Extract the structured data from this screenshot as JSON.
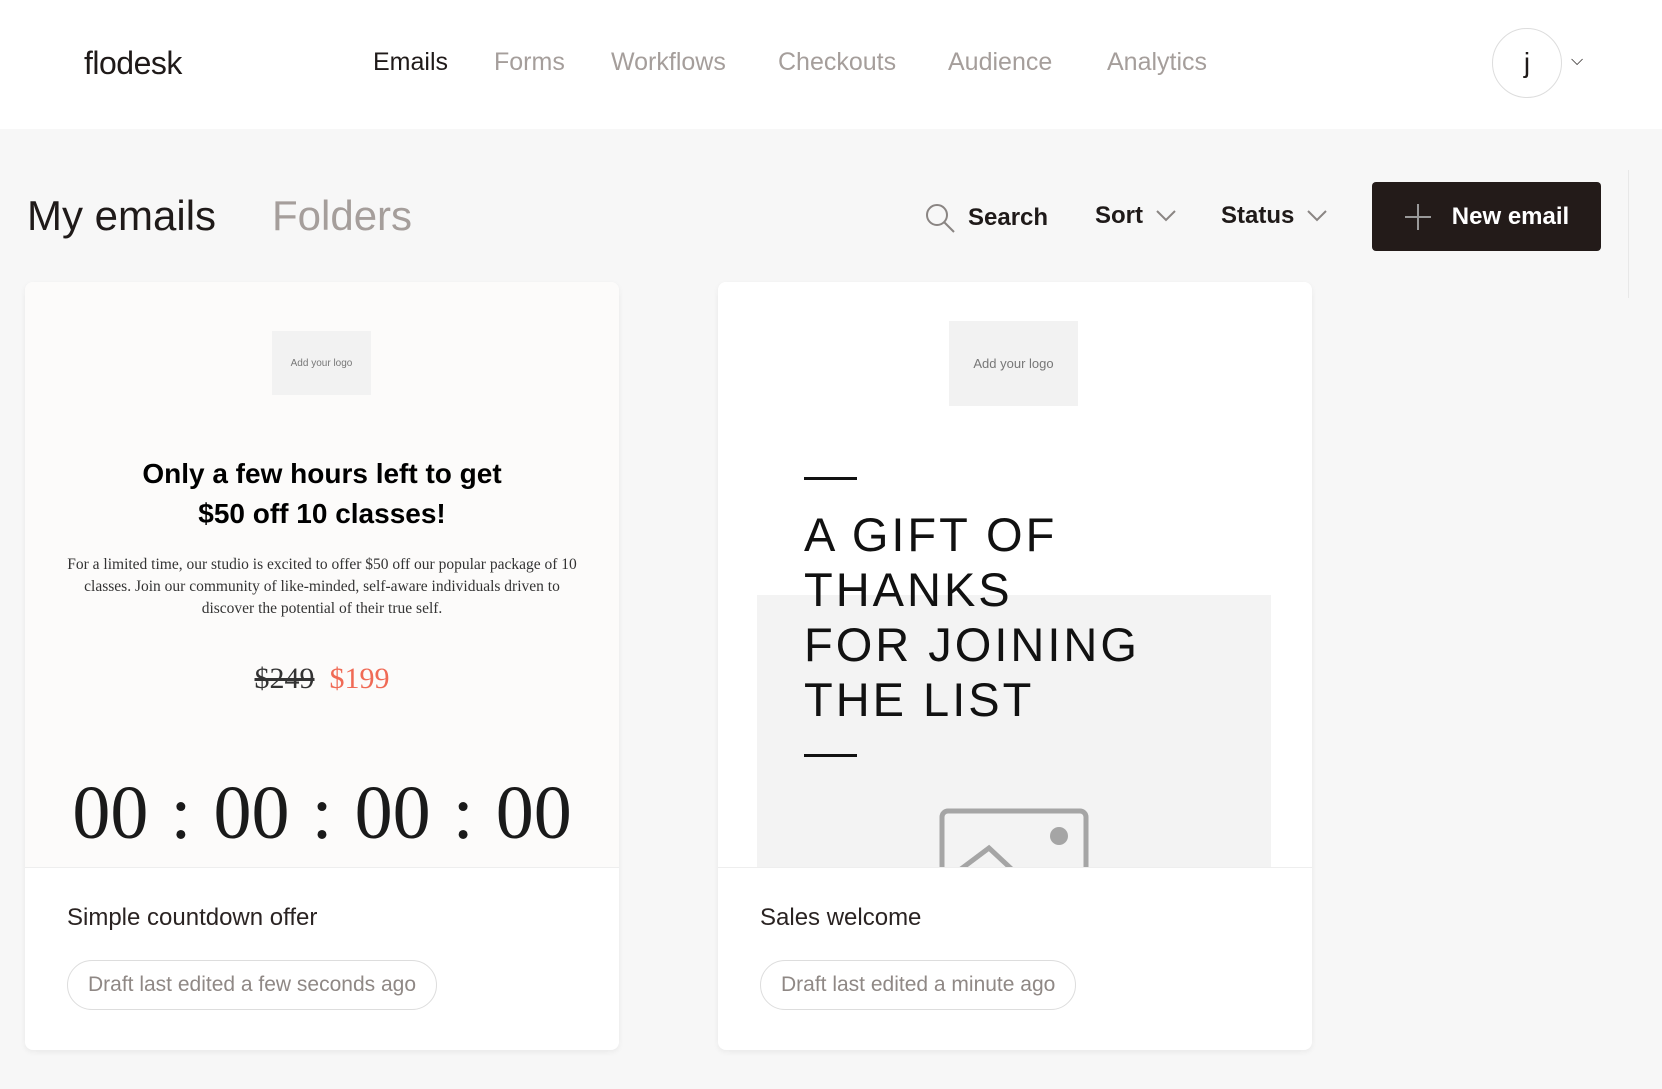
{
  "header": {
    "logo": "flodesk",
    "nav": [
      "Emails",
      "Forms",
      "Workflows",
      "Checkouts",
      "Audience",
      "Analytics"
    ],
    "active": "Emails",
    "avatar_initial": "j"
  },
  "toolbar": {
    "title": "My emails",
    "folders": "Folders",
    "search": "Search",
    "sort": "Sort",
    "status": "Status",
    "new_email": "New email"
  },
  "cards": [
    {
      "name": "Simple countdown offer",
      "status": "Draft last edited a few seconds ago",
      "preview": {
        "logo": "Add your logo",
        "headline1": "Only a few hours left to get",
        "headline2": "$50 off 10 classes!",
        "body": "For a limited time, our studio is excited to offer $50 off our popular package of 10 classes. Join our community of like-minded, self-aware individuals driven to discover the potential of their true self.",
        "old_price": "$249",
        "new_price": "$199",
        "countdown": [
          "00",
          "00",
          "00",
          "00"
        ]
      }
    },
    {
      "name": "Sales welcome",
      "status": "Draft last edited a minute ago",
      "preview": {
        "logo": "Add your logo",
        "headline": [
          "A GIFT OF",
          "THANKS",
          "FOR JOINING",
          "THE LIST"
        ]
      }
    }
  ],
  "colors": {
    "accent_price": "#f06a55",
    "button": "#231b19"
  }
}
